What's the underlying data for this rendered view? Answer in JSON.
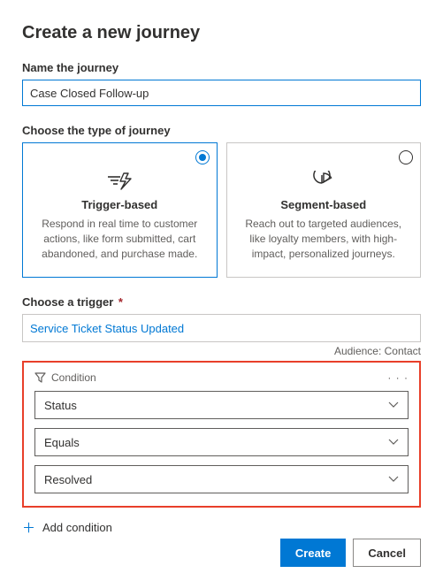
{
  "title": "Create a new journey",
  "nameSection": {
    "label": "Name the journey",
    "value": "Case Closed Follow-up"
  },
  "typeSection": {
    "label": "Choose the type of journey",
    "cards": [
      {
        "title": "Trigger-based",
        "text": "Respond in real time to customer actions, like form submitted, cart abandoned, and purchase made."
      },
      {
        "title": "Segment-based",
        "text": "Reach out to targeted audiences, like loyalty members, with high-impact, personalized journeys."
      }
    ]
  },
  "triggerSection": {
    "label": "Choose a trigger",
    "value": "Service Ticket Status Updated",
    "audience": "Audience: Contact"
  },
  "condition": {
    "label": "Condition",
    "attribute": "Status",
    "operator": "Equals",
    "value": "Resolved"
  },
  "addCondition": "Add condition",
  "buttons": {
    "create": "Create",
    "cancel": "Cancel"
  }
}
